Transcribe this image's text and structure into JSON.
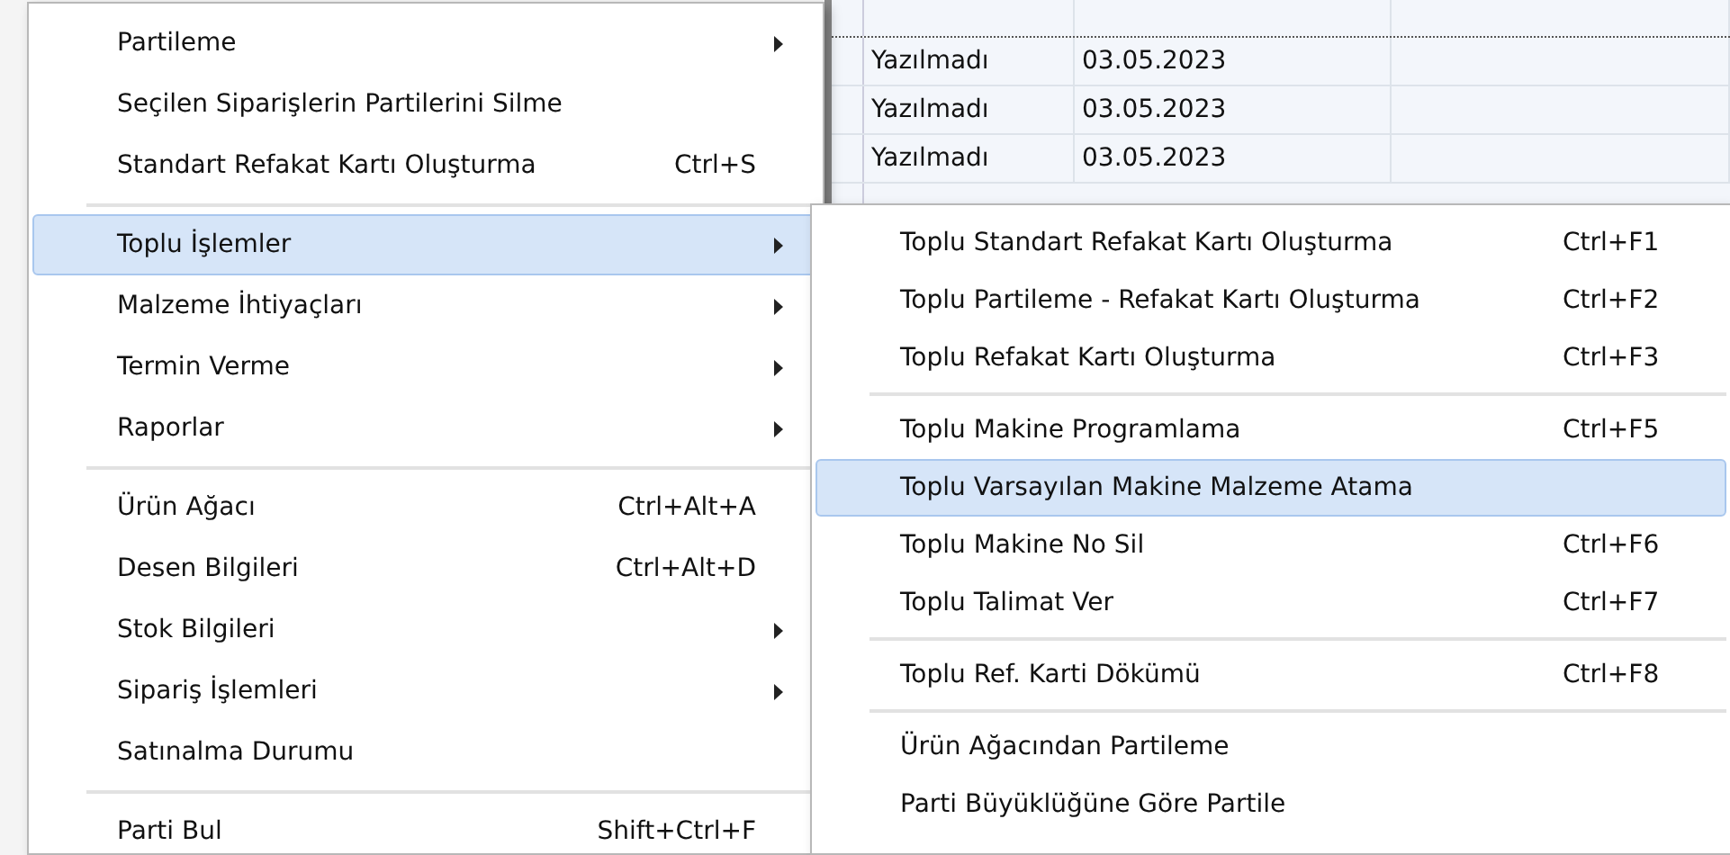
{
  "grid": {
    "rows": [
      {
        "status": "Yazılmadı",
        "date": "03.05.2023"
      },
      {
        "status": "Yazılmadı",
        "date": "03.05.2023"
      },
      {
        "status": "Yazılmadı",
        "date": "03.05.2023"
      }
    ]
  },
  "menu": {
    "items": [
      {
        "kind": "item",
        "label": "Partileme",
        "has_submenu": true,
        "selected": false
      },
      {
        "kind": "item",
        "label": "Seçilen Siparişlerin Partilerini Silme",
        "has_submenu": false,
        "selected": false
      },
      {
        "kind": "item",
        "label": "Standart Refakat Kartı Oluşturma",
        "shortcut": "Ctrl+S",
        "has_submenu": false,
        "selected": false
      },
      {
        "kind": "separator"
      },
      {
        "kind": "item",
        "label": "Toplu İşlemler",
        "has_submenu": true,
        "selected": true
      },
      {
        "kind": "item",
        "label": "Malzeme İhtiyaçları",
        "has_submenu": true,
        "selected": false
      },
      {
        "kind": "item",
        "label": "Termin Verme",
        "has_submenu": true,
        "selected": false
      },
      {
        "kind": "item",
        "label": "Raporlar",
        "has_submenu": true,
        "selected": false
      },
      {
        "kind": "separator"
      },
      {
        "kind": "item",
        "label": "Ürün Ağacı",
        "shortcut": "Ctrl+Alt+A",
        "has_submenu": false,
        "selected": false
      },
      {
        "kind": "item",
        "label": "Desen Bilgileri",
        "shortcut": "Ctrl+Alt+D",
        "has_submenu": false,
        "selected": false
      },
      {
        "kind": "item",
        "label": "Stok Bilgileri",
        "has_submenu": true,
        "selected": false
      },
      {
        "kind": "item",
        "label": "Sipariş İşlemleri",
        "has_submenu": true,
        "selected": false
      },
      {
        "kind": "item",
        "label": "Satınalma Durumu",
        "has_submenu": false,
        "selected": false
      },
      {
        "kind": "separator"
      },
      {
        "kind": "item",
        "label": "Parti Bul",
        "shortcut": "Shift+Ctrl+F",
        "has_submenu": false,
        "selected": false
      }
    ]
  },
  "submenu": {
    "items": [
      {
        "kind": "item",
        "label": "Toplu Standart Refakat Kartı Oluşturma",
        "shortcut": "Ctrl+F1",
        "selected": false
      },
      {
        "kind": "item",
        "label": "Toplu Partileme - Refakat Kartı Oluşturma",
        "shortcut": "Ctrl+F2",
        "selected": false
      },
      {
        "kind": "item",
        "label": "Toplu Refakat Kartı Oluşturma",
        "shortcut": "Ctrl+F3",
        "selected": false
      },
      {
        "kind": "separator"
      },
      {
        "kind": "item",
        "label": "Toplu Makine Programlama",
        "shortcut": "Ctrl+F5",
        "selected": false
      },
      {
        "kind": "item",
        "label": "Toplu Varsayılan Makine Malzeme Atama",
        "selected": true
      },
      {
        "kind": "item",
        "label": "Toplu Makine No Sil",
        "shortcut": "Ctrl+F6",
        "selected": false
      },
      {
        "kind": "item",
        "label": "Toplu Talimat Ver",
        "shortcut": "Ctrl+F7",
        "selected": false
      },
      {
        "kind": "separator"
      },
      {
        "kind": "item",
        "label": "Toplu Ref. Karti Dökümü",
        "shortcut": "Ctrl+F8",
        "selected": false
      },
      {
        "kind": "separator"
      },
      {
        "kind": "item",
        "label": "Ürün Ağacından Partileme",
        "selected": false
      },
      {
        "kind": "item",
        "label": "Parti Büyüklüğüne Göre Partile",
        "selected": false
      }
    ]
  }
}
